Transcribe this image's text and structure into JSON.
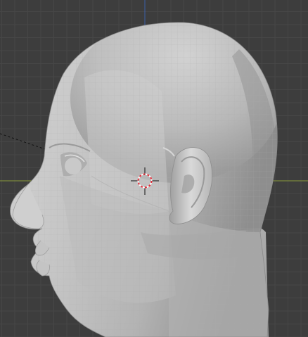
{
  "viewport": {
    "view": "side",
    "background_color": "#3d3d3d",
    "grid_minor_color": "#474747",
    "grid_major_color": "#505050",
    "x_axis_color": "#8a9a3c",
    "z_axis_color": "#3c5fa8",
    "model_base_color": "#b8b8b8",
    "wireframe_color": "#a5a5a5"
  },
  "model": {
    "name": "head",
    "shading": "solid"
  },
  "cursor_3d": {
    "icon": "crosshair-icon",
    "ring_colors": [
      "#ffffff",
      "#e2303c"
    ]
  },
  "camera_line": {
    "style": "dashed",
    "color": "#111111"
  }
}
